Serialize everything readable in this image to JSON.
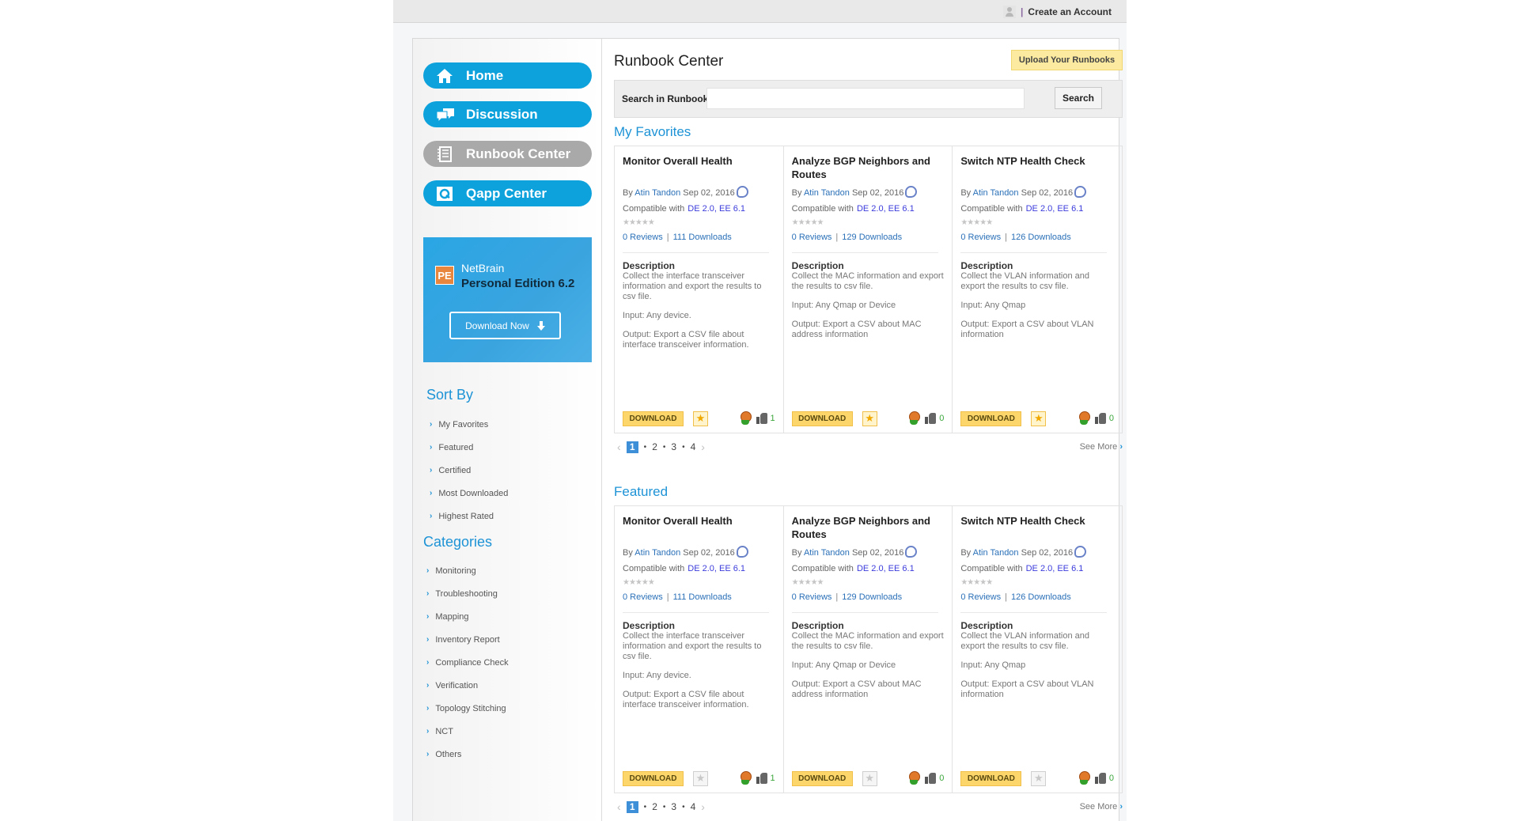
{
  "header": {
    "create_account": "Create an Account",
    "separator": "|"
  },
  "sidebar": {
    "nav": [
      {
        "label": "Home",
        "icon": "home-icon",
        "active": false
      },
      {
        "label": "Discussion",
        "icon": "discussion-icon",
        "active": false
      },
      {
        "label": "Runbook Center",
        "icon": "runbook-icon",
        "active": true
      },
      {
        "label": "Qapp  Center",
        "icon": "qapp-icon",
        "active": false
      }
    ],
    "promo": {
      "badge": "PE",
      "brand": "NetBrain",
      "edition": "Personal Edition 6.2",
      "button": "Download Now"
    },
    "sort_by": {
      "title": "Sort By",
      "items": [
        "My Favorites",
        "Featured",
        "Certified",
        "Most Downloaded",
        "Highest Rated"
      ]
    },
    "categories": {
      "title": "Categories",
      "items": [
        "Monitoring",
        "Troubleshooting",
        "Mapping",
        "Inventory Report",
        "Compliance Check",
        "Verification",
        "Topology Stitching",
        "NCT",
        "Others"
      ]
    }
  },
  "main": {
    "title": "Runbook Center",
    "upload_button": "Upload Your Runbooks",
    "search": {
      "label": "Search in Runbooks",
      "value": "",
      "placeholder": "",
      "button": "Search"
    },
    "sections": [
      {
        "title": "My Favorites",
        "cards": [
          {
            "title": "Monitor Overall Health",
            "by": "By",
            "author": "Atin Tandon",
            "date": "Sep 02, 2016",
            "compat_label": "Compatible with",
            "compat": "DE 2.0, EE 6.1",
            "stars": "★★★★★",
            "reviews": "0  Reviews",
            "downloads": "111  Downloads",
            "desc_head": "Description",
            "desc": "Collect the interface transceiver information and export the results to csv file.",
            "input": "Input: Any device.",
            "output": "Output: Export a CSV file about interface transceiver information.",
            "download": "DOWNLOAD",
            "favorited": true,
            "likes": "1"
          },
          {
            "title": "Analyze BGP Neighbors and Routes",
            "by": "By",
            "author": "Atin Tandon",
            "date": "Sep 02, 2016",
            "compat_label": "Compatible with",
            "compat": "DE 2.0, EE 6.1",
            "stars": "★★★★★",
            "reviews": "0  Reviews",
            "downloads": "129  Downloads",
            "desc_head": "Description",
            "desc": "Collect the MAC information and export the results to csv file.",
            "input": "Input: Any Qmap or Device",
            "output": "Output: Export a CSV about MAC address information",
            "download": "DOWNLOAD",
            "favorited": true,
            "likes": "0"
          },
          {
            "title": "Switch NTP Health Check",
            "by": "By",
            "author": "Atin Tandon",
            "date": "Sep 02, 2016",
            "compat_label": "Compatible with",
            "compat": "DE 2.0, EE 6.1",
            "stars": "★★★★★",
            "reviews": "0  Reviews",
            "downloads": "126  Downloads",
            "desc_head": "Description",
            "desc": "Collect the VLAN information and export the results to csv file.",
            "input": "Input: Any Qmap",
            "output": "Output: Export a CSV about VLAN information",
            "download": "DOWNLOAD",
            "favorited": true,
            "likes": "0"
          }
        ],
        "pager": {
          "prev": "‹",
          "pages": [
            "1",
            "2",
            "3",
            "4"
          ],
          "current": "1",
          "next": "›"
        },
        "see_more": "See More",
        "see_more_chevron": "›"
      },
      {
        "title": "Featured",
        "cards": [
          {
            "title": "Monitor Overall Health",
            "by": "By",
            "author": "Atin Tandon",
            "date": "Sep 02, 2016",
            "compat_label": "Compatible with",
            "compat": "DE 2.0, EE 6.1",
            "stars": "★★★★★",
            "reviews": "0  Reviews",
            "downloads": "111  Downloads",
            "desc_head": "Description",
            "desc": "Collect the interface transceiver information and export the results to csv file.",
            "input": "Input: Any device.",
            "output": "Output: Export a CSV file about interface transceiver information.",
            "download": "DOWNLOAD",
            "favorited": false,
            "likes": "1"
          },
          {
            "title": "Analyze BGP Neighbors and Routes",
            "by": "By",
            "author": "Atin Tandon",
            "date": "Sep 02, 2016",
            "compat_label": "Compatible with",
            "compat": "DE 2.0, EE 6.1",
            "stars": "★★★★★",
            "reviews": "0  Reviews",
            "downloads": "129  Downloads",
            "desc_head": "Description",
            "desc": "Collect the MAC information and export the results to csv file.",
            "input": "Input: Any Qmap or Device",
            "output": "Output: Export a CSV about MAC address information",
            "download": "DOWNLOAD",
            "favorited": false,
            "likes": "0"
          },
          {
            "title": "Switch NTP Health Check",
            "by": "By",
            "author": "Atin Tandon",
            "date": "Sep 02, 2016",
            "compat_label": "Compatible with",
            "compat": "DE 2.0, EE 6.1",
            "stars": "★★★★★",
            "reviews": "0  Reviews",
            "downloads": "126  Downloads",
            "desc_head": "Description",
            "desc": "Collect the VLAN information and export the results to csv file.",
            "input": "Input: Any Qmap",
            "output": "Output: Export a CSV about VLAN information",
            "download": "DOWNLOAD",
            "favorited": false,
            "likes": "0"
          }
        ],
        "pager": {
          "prev": "‹",
          "pages": [
            "1",
            "2",
            "3",
            "4"
          ],
          "current": "1",
          "next": "›"
        },
        "see_more": "See More",
        "see_more_chevron": "›"
      }
    ]
  },
  "colors": {
    "accent": "#1d93d6",
    "nav_active": "#a9a9a9",
    "nav": "#0ea2dd",
    "download_button": "#fcd66a",
    "upload_button": "#fbeaa0"
  }
}
